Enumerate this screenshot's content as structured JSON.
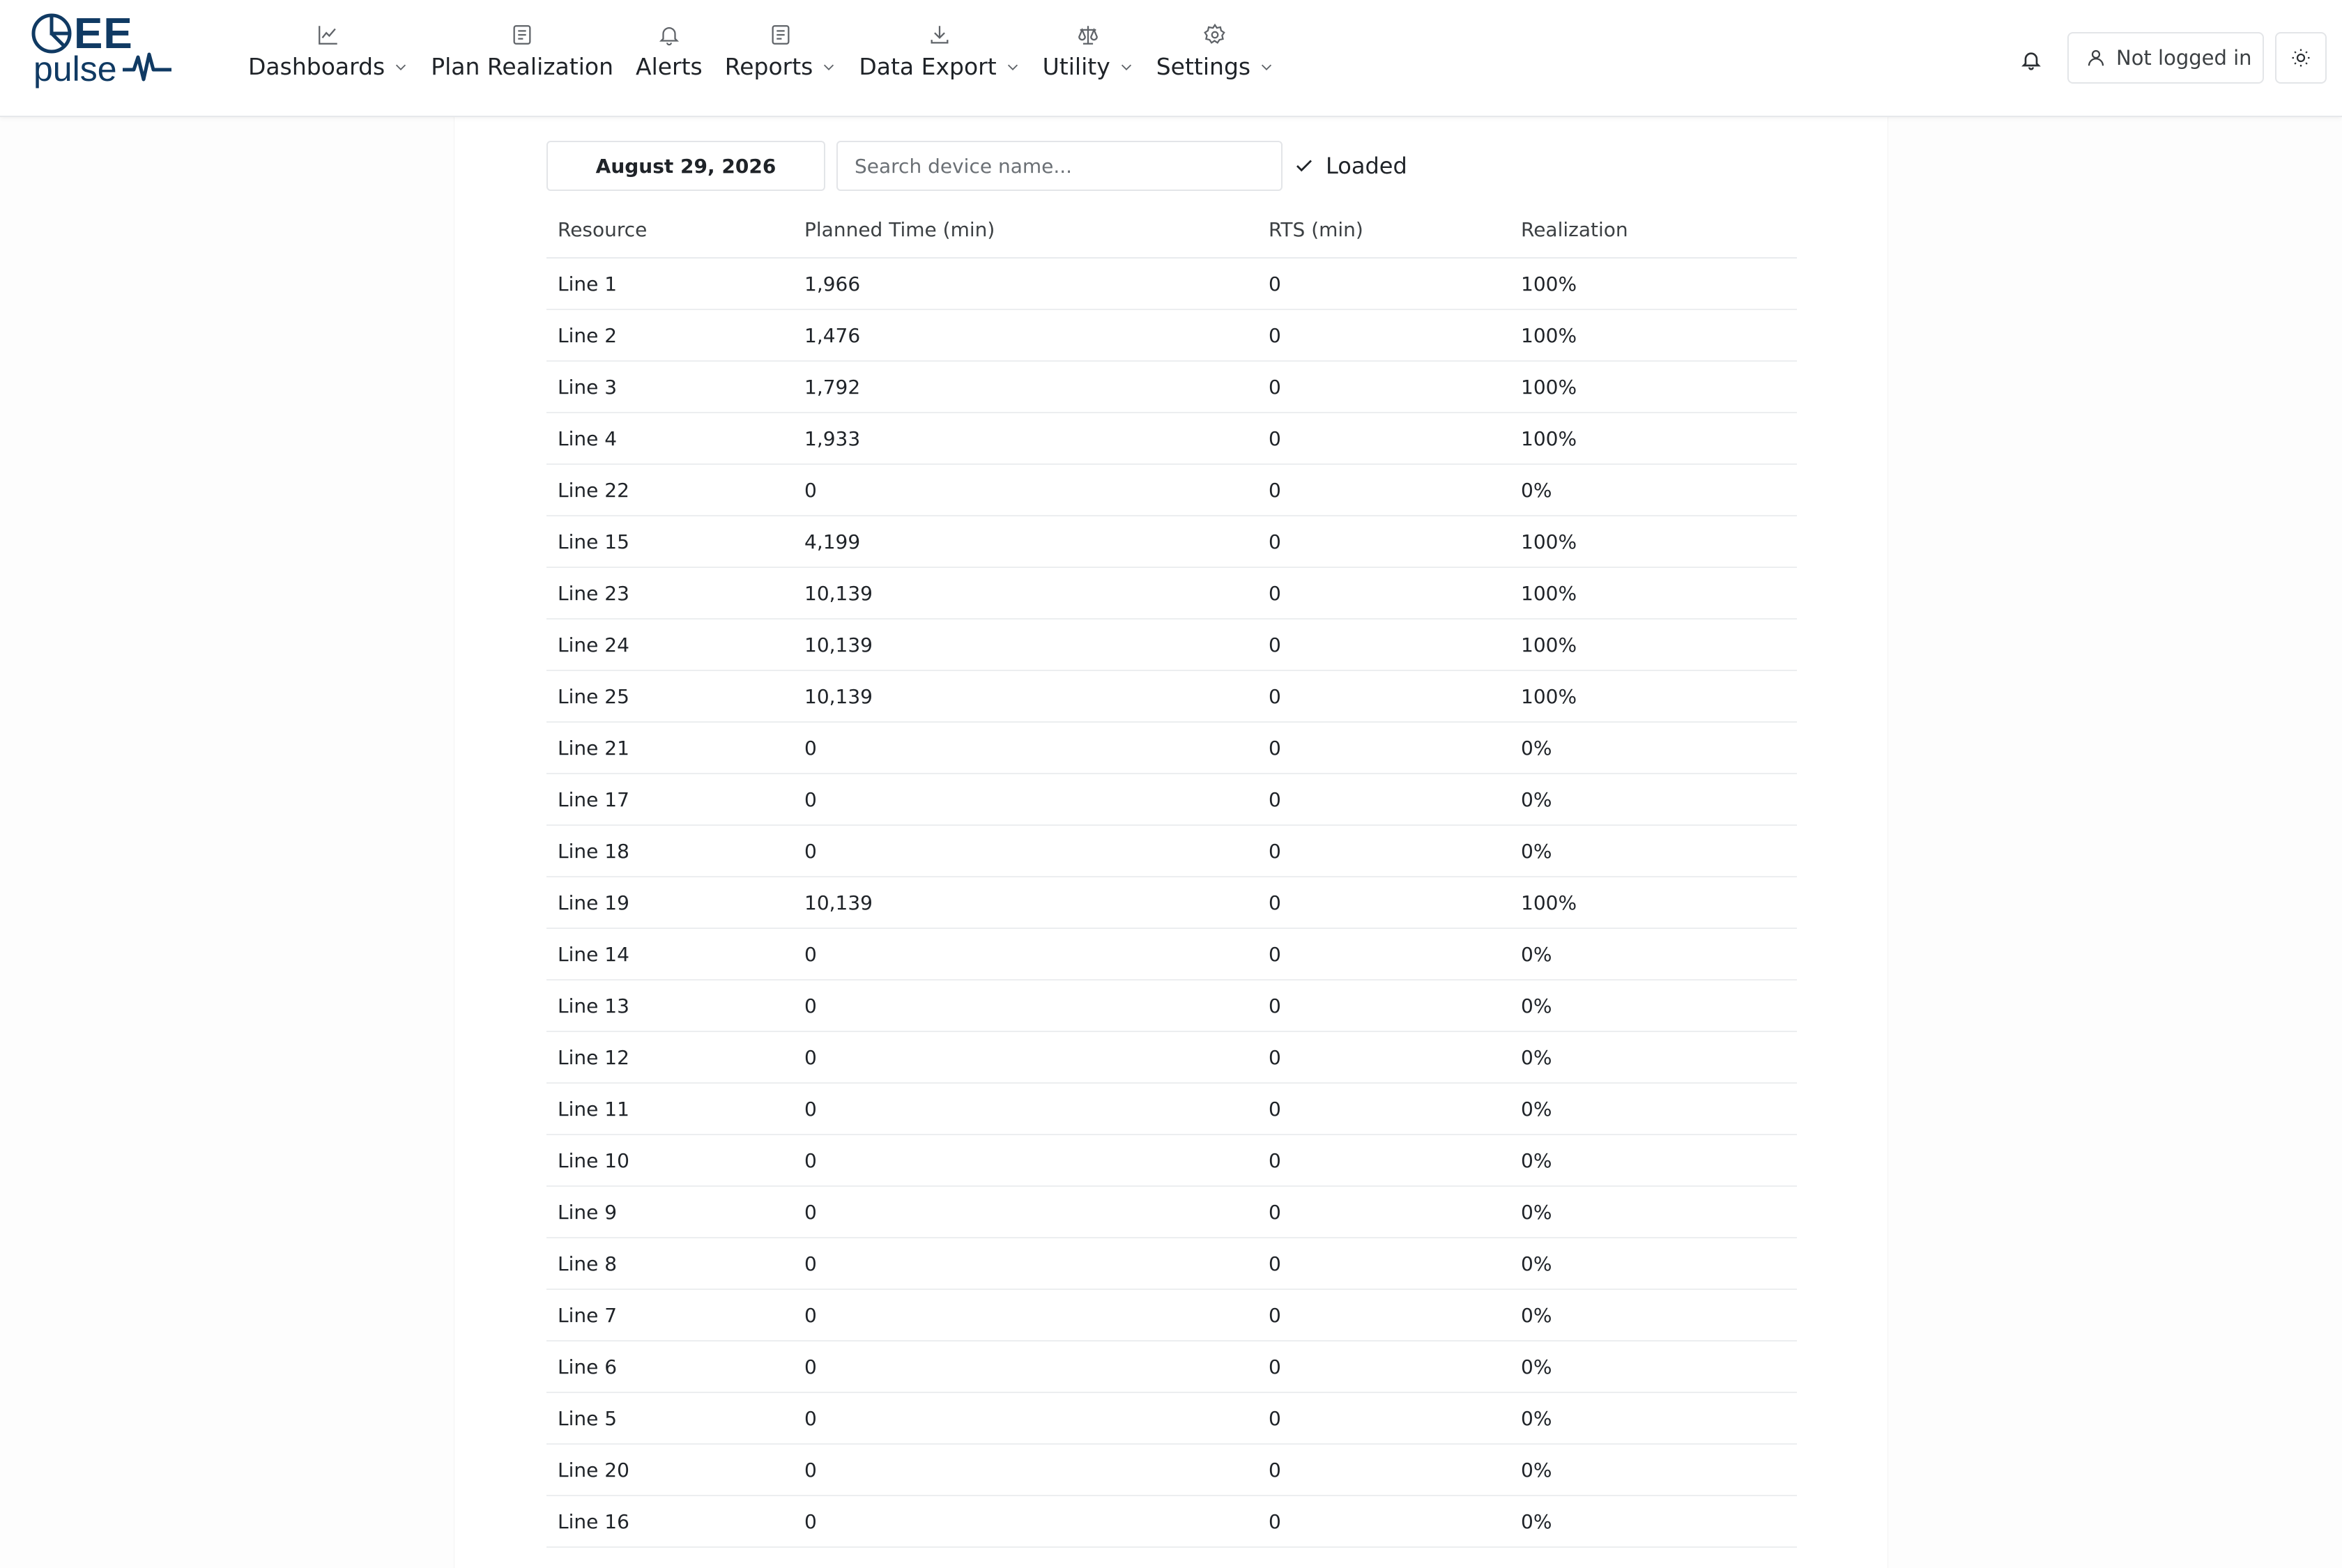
{
  "brand": {
    "name_top": "EE",
    "name_bottom": "pulse",
    "color": "#103a63"
  },
  "nav": [
    {
      "label": "Dashboards",
      "icon": "chart-line-icon",
      "has_dropdown": true
    },
    {
      "label": "Plan Realization",
      "icon": "document-list-icon",
      "has_dropdown": false
    },
    {
      "label": "Alerts",
      "icon": "bell-icon",
      "has_dropdown": false
    },
    {
      "label": "Reports",
      "icon": "document-list-icon",
      "has_dropdown": true
    },
    {
      "label": "Data Export",
      "icon": "download-icon",
      "has_dropdown": true
    },
    {
      "label": "Utility",
      "icon": "scale-icon",
      "has_dropdown": true
    },
    {
      "label": "Settings",
      "icon": "gear-icon",
      "has_dropdown": true
    }
  ],
  "header_actions": {
    "notifications_icon": "bell-icon",
    "login_label": "Not logged in",
    "login_icon": "user-icon",
    "theme_icon": "sun-icon"
  },
  "toolbar": {
    "date": "August 29, 2026",
    "search_placeholder": "Search device name...",
    "search_value": "",
    "status_label": "Loaded",
    "status_icon": "check-icon"
  },
  "table": {
    "columns": [
      "Resource",
      "Planned Time (min)",
      "RTS (min)",
      "Realization"
    ],
    "rows": [
      [
        "Line 1",
        "1,966",
        "0",
        "100%"
      ],
      [
        "Line 2",
        "1,476",
        "0",
        "100%"
      ],
      [
        "Line 3",
        "1,792",
        "0",
        "100%"
      ],
      [
        "Line 4",
        "1,933",
        "0",
        "100%"
      ],
      [
        "Line 22",
        "0",
        "0",
        "0%"
      ],
      [
        "Line 15",
        "4,199",
        "0",
        "100%"
      ],
      [
        "Line 23",
        "10,139",
        "0",
        "100%"
      ],
      [
        "Line 24",
        "10,139",
        "0",
        "100%"
      ],
      [
        "Line 25",
        "10,139",
        "0",
        "100%"
      ],
      [
        "Line 21",
        "0",
        "0",
        "0%"
      ],
      [
        "Line 17",
        "0",
        "0",
        "0%"
      ],
      [
        "Line 18",
        "0",
        "0",
        "0%"
      ],
      [
        "Line 19",
        "10,139",
        "0",
        "100%"
      ],
      [
        "Line 14",
        "0",
        "0",
        "0%"
      ],
      [
        "Line 13",
        "0",
        "0",
        "0%"
      ],
      [
        "Line 12",
        "0",
        "0",
        "0%"
      ],
      [
        "Line 11",
        "0",
        "0",
        "0%"
      ],
      [
        "Line 10",
        "0",
        "0",
        "0%"
      ],
      [
        "Line 9",
        "0",
        "0",
        "0%"
      ],
      [
        "Line 8",
        "0",
        "0",
        "0%"
      ],
      [
        "Line 7",
        "0",
        "0",
        "0%"
      ],
      [
        "Line 6",
        "0",
        "0",
        "0%"
      ],
      [
        "Line 5",
        "0",
        "0",
        "0%"
      ],
      [
        "Line 20",
        "0",
        "0",
        "0%"
      ],
      [
        "Line 16",
        "0",
        "0",
        "0%"
      ]
    ]
  }
}
